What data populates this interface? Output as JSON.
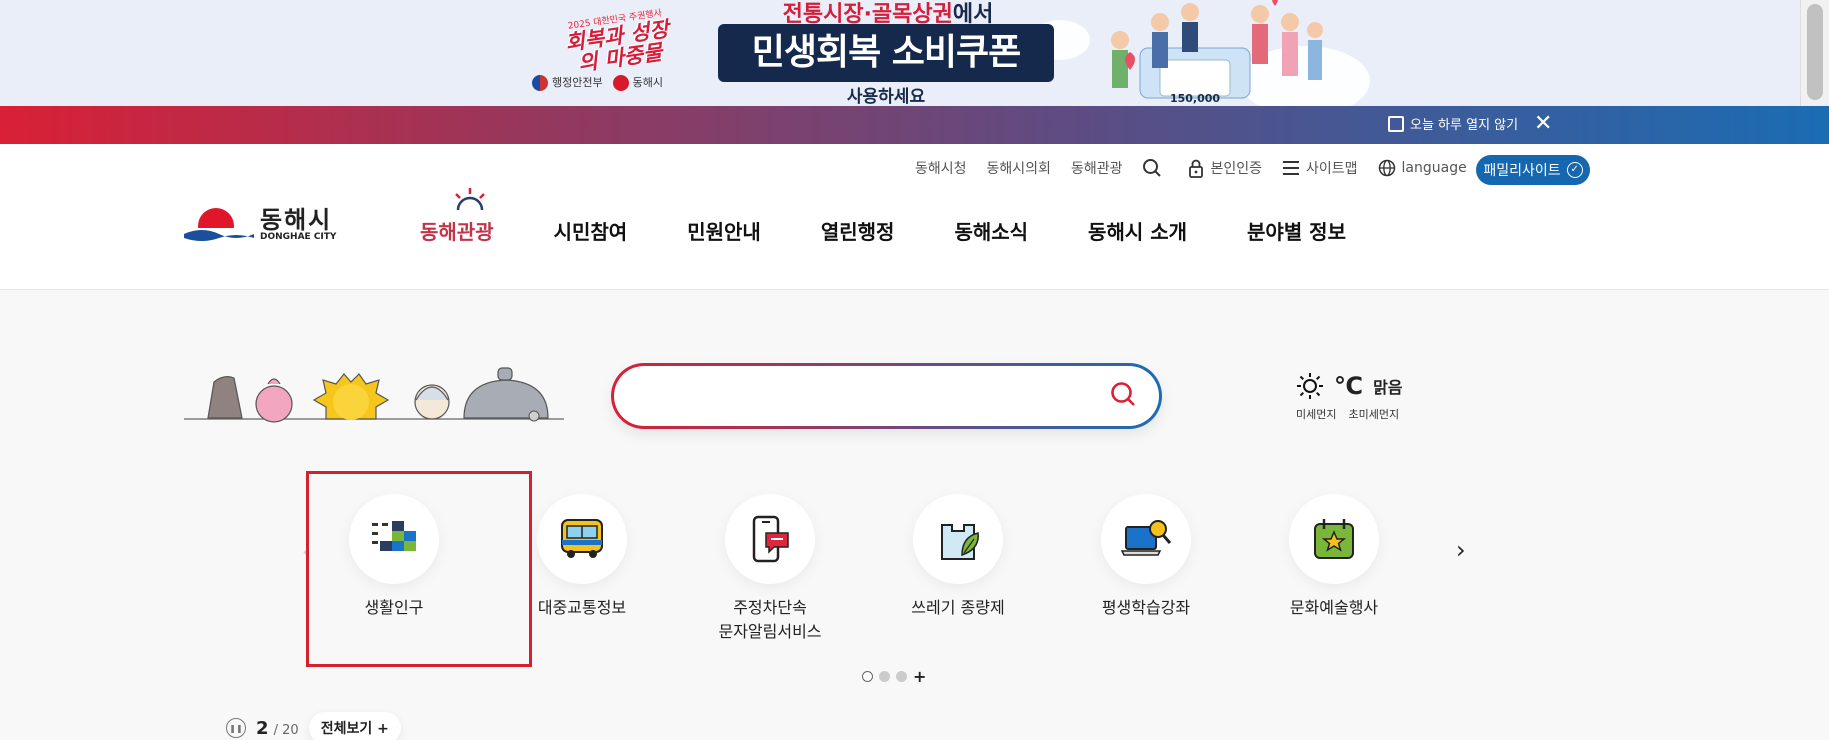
{
  "promo": {
    "logo_small": "2025 대한민국 주권행사",
    "logo_main": "회복과 성장의 마중물",
    "org1": "행정안전부",
    "org2": "동해시",
    "headline": "전통시장·골목상권",
    "headline_tail": "에서",
    "main": "민생회복 소비쿠폰",
    "sub": "사용하세요",
    "amount": "150,000"
  },
  "strip": {
    "no_show_today": "오늘 하루 열지 않기",
    "close": "✕"
  },
  "util": {
    "links": [
      "동해시청",
      "동해시의회",
      "동해관광"
    ],
    "verify": "본인인증",
    "sitemap": "사이트맵",
    "language": "language",
    "family": "패밀리사이트"
  },
  "logo": {
    "kor": "동해시",
    "eng": "DONGHAE CITY"
  },
  "gnb": [
    "동해관광",
    "시민참여",
    "민원안내",
    "열린행정",
    "동해소식",
    "동해시 소개",
    "분야별 정보"
  ],
  "weather": {
    "degree": "℃",
    "condition": "맑음",
    "dust": "미세먼지",
    "fine_dust": "초미세먼지"
  },
  "quick": [
    {
      "label": "생활인구",
      "icon": "bar-blocks-icon"
    },
    {
      "label": "대중교통정보",
      "icon": "bus-icon"
    },
    {
      "label": "주정차단속\n문자알림서비스",
      "icon": "phone-message-icon"
    },
    {
      "label": "쓰레기 종량제",
      "icon": "trash-bag-icon"
    },
    {
      "label": "평생학습강좌",
      "icon": "laptop-search-icon"
    },
    {
      "label": "문화예술행사",
      "icon": "calendar-star-icon"
    }
  ],
  "pager": {
    "current": "2",
    "total": "/ 20",
    "all": "전체보기 +"
  },
  "colors": {
    "accent_red": "#d92036",
    "accent_blue": "#1b6cb3",
    "family_blue": "#1568b0",
    "active_menu": "#c0354a"
  }
}
